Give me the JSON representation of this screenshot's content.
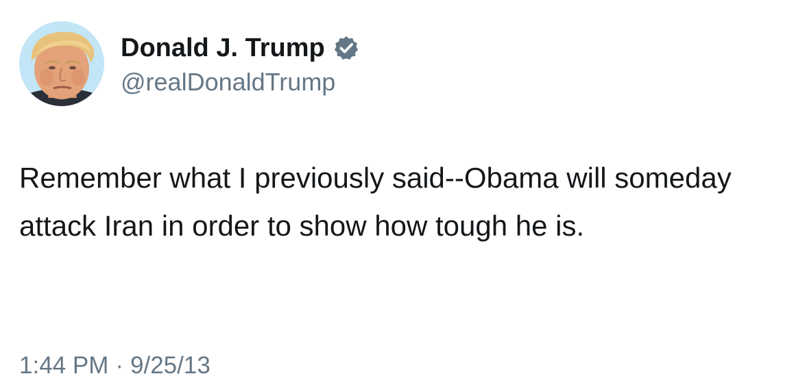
{
  "author": {
    "display_name": "Donald J. Trump",
    "handle": "@realDonaldTrump",
    "verified": true,
    "verified_color": "#657786"
  },
  "tweet": {
    "text": "Remember what I previously said--Obama will someday attack Iran in order to show how tough he is.",
    "time": "1:44 PM",
    "separator": "·",
    "date": "9/25/13"
  },
  "colors": {
    "text": "#14171a",
    "secondary_text": "#657786",
    "background": "#ffffff"
  }
}
